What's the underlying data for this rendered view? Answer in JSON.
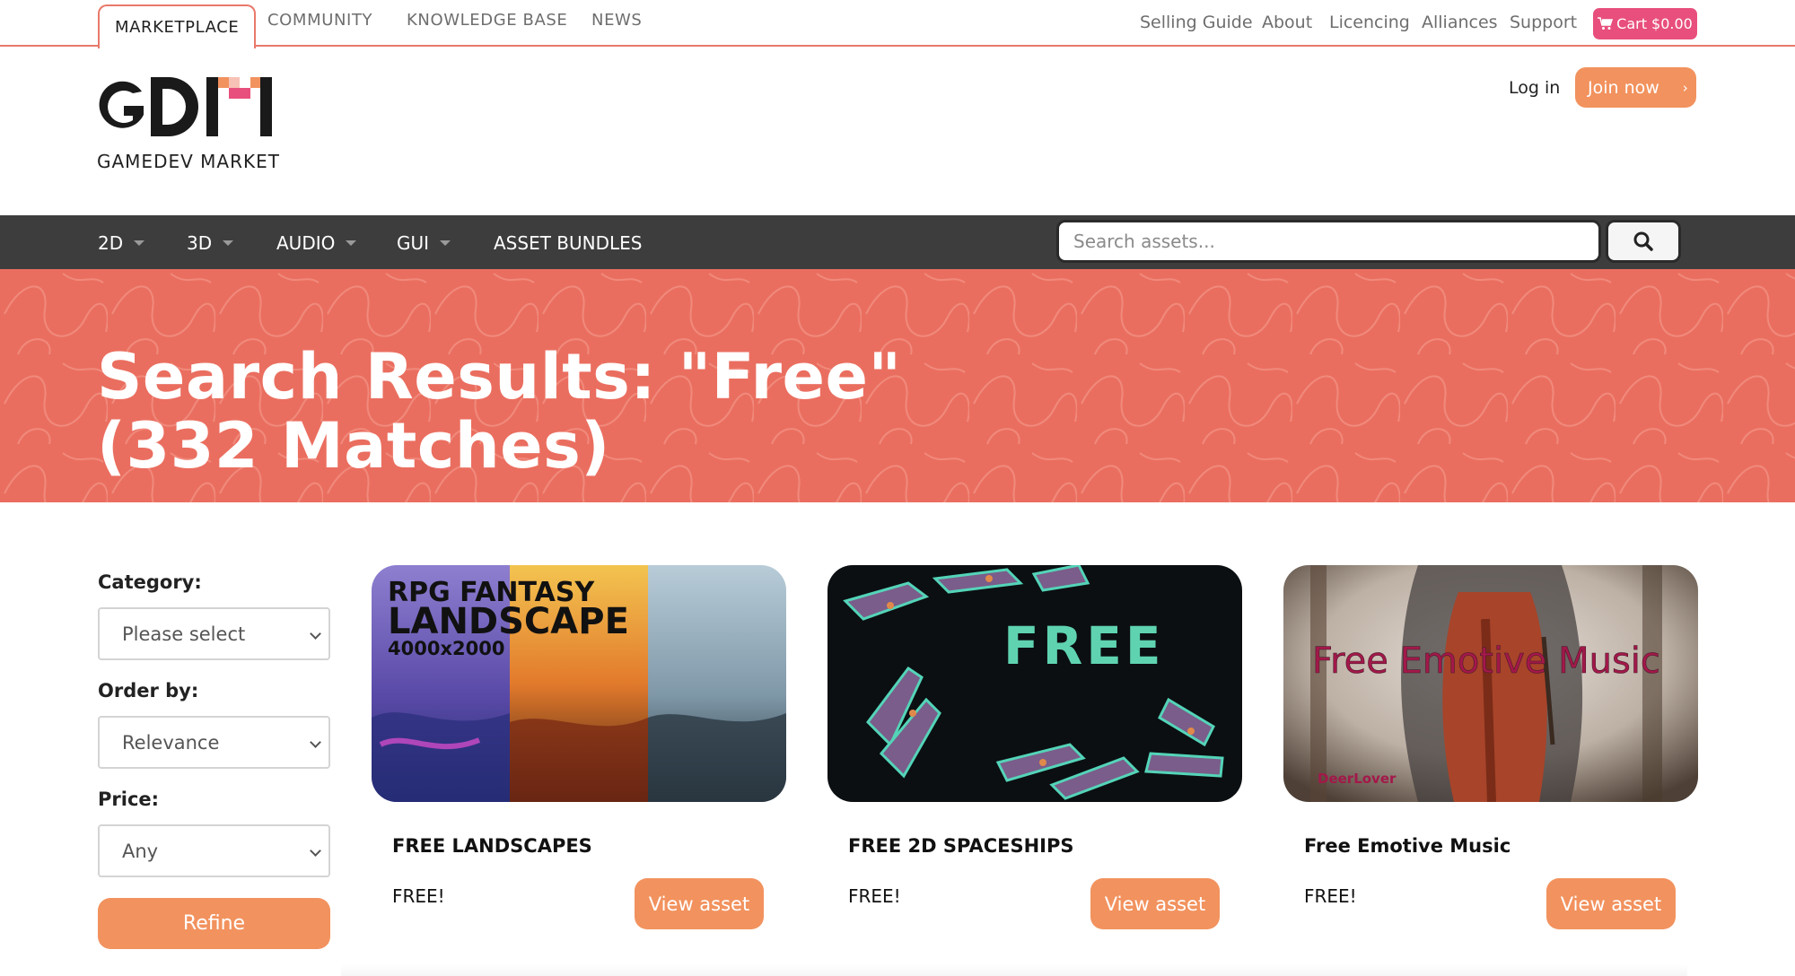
{
  "topbar": {
    "tabs": [
      {
        "label": "MARKETPLACE",
        "active": true
      },
      {
        "label": "COMMUNITY",
        "active": false
      },
      {
        "label": "KNOWLEDGE BASE",
        "active": false
      },
      {
        "label": "NEWS",
        "active": false
      }
    ],
    "links": [
      "Selling Guide",
      "About",
      "Licencing",
      "Alliances",
      "Support"
    ],
    "cart_label": "Cart $0.00",
    "cart_icon": "shopping-cart-icon"
  },
  "header": {
    "logo_text": "GDM",
    "logo_subtitle": "GAMEDEV MARKET",
    "login_label": "Log in",
    "join_label": "Join now"
  },
  "nav": {
    "items": [
      {
        "label": "2D",
        "dropdown": true
      },
      {
        "label": "3D",
        "dropdown": true
      },
      {
        "label": "AUDIO",
        "dropdown": true
      },
      {
        "label": "GUI",
        "dropdown": true
      },
      {
        "label": "ASSET BUNDLES",
        "dropdown": false
      }
    ],
    "search_placeholder": "Search assets...",
    "search_icon": "search-icon"
  },
  "hero": {
    "title_line1": "Search Results: \"Free\"",
    "title_line2": "(332 Matches)"
  },
  "filters": {
    "category_label": "Category:",
    "category_value": "Please select",
    "order_label": "Order by:",
    "order_value": "Relevance",
    "price_label": "Price:",
    "price_value": "Any",
    "refine_label": "Refine"
  },
  "assets": [
    {
      "title": "FREE LANDSCAPES",
      "price": "FREE!",
      "button": "View asset",
      "thumb_text_1": "RPG FANTASY",
      "thumb_text_2": "LANDSCAPE",
      "thumb_text_3": "4000x2000"
    },
    {
      "title": "FREE 2D SPACESHIPS",
      "price": "FREE!",
      "button": "View asset",
      "thumb_text_1": "FREE"
    },
    {
      "title": "Free Emotive Music",
      "price": "FREE!",
      "button": "View asset",
      "thumb_text_1": "Free Emotive Music",
      "thumb_text_2": "DeerLover"
    }
  ],
  "colors": {
    "accent": "#e9786b",
    "hero_bg": "#ea6e5f",
    "button": "#f2925e",
    "cart": "#e84f7c",
    "nav_bg": "#3d3d3d"
  }
}
